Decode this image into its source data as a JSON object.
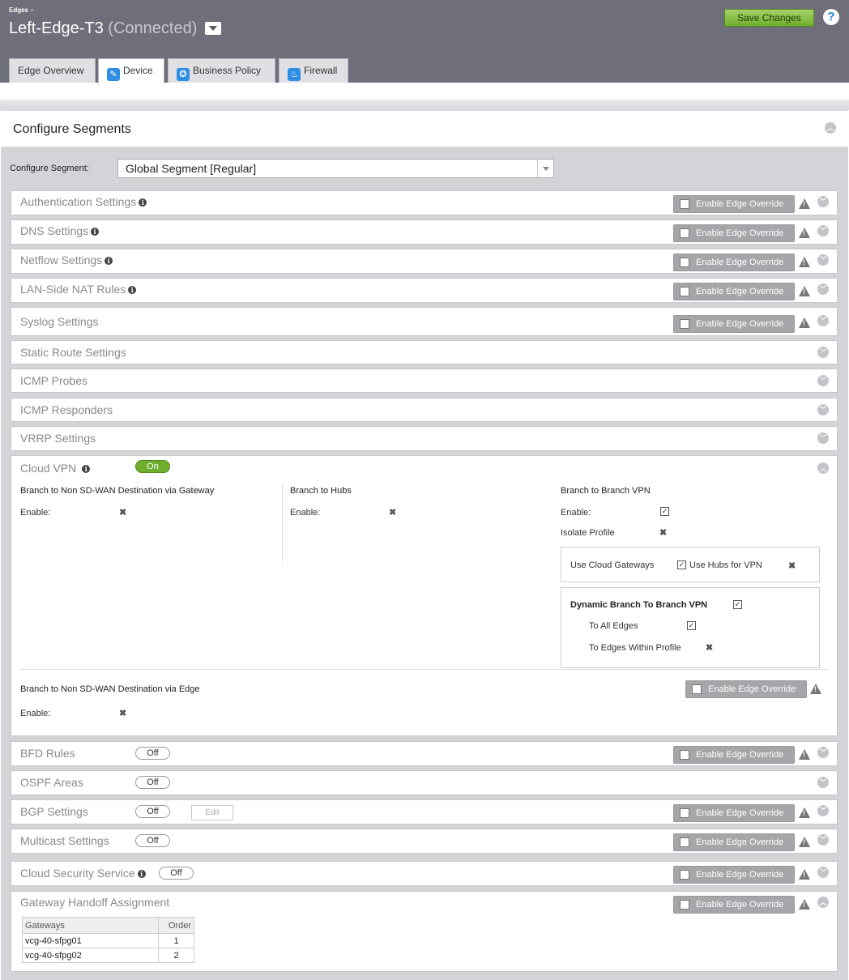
{
  "header": {
    "breadcrumb": "Edges",
    "breadcrumb_sep": "»",
    "edge_name": "Left-Edge-T3",
    "edge_status": "(Connected)",
    "save_label": "Save Changes",
    "help": "?"
  },
  "tabs": [
    {
      "label": "Edge Overview"
    },
    {
      "label": "Device"
    },
    {
      "label": "Business Policy"
    },
    {
      "label": "Firewall"
    }
  ],
  "section_title": "Configure Segments",
  "segment": {
    "label": "Configure Segment:",
    "value": "Global Segment [Regular]"
  },
  "override_label": "Enable Edge Override",
  "panels": {
    "auth": "Authentication Settings",
    "dns": "DNS Settings",
    "netflow": "Netflow Settings",
    "lan_nat": "LAN-Side NAT Rules",
    "syslog": "Syslog Settings",
    "static_route": "Static Route Settings",
    "icmp_probes": "ICMP Probes",
    "icmp_responders": "ICMP Responders",
    "vrrp": "VRRP Settings",
    "cloud_vpn": "Cloud VPN",
    "bfd": "BFD Rules",
    "ospf": "OSPF Areas",
    "bgp": "BGP Settings",
    "multicast": "Multicast Settings",
    "css": "Cloud Security Service",
    "gw_handoff": "Gateway Handoff Assignment"
  },
  "toggles": {
    "on": "On",
    "off": "Off"
  },
  "edit_label": "Edit",
  "vpn": {
    "gw_heading": "Branch to Non SD-WAN Destination via Gateway",
    "hubs_heading": "Branch to Hubs",
    "b2b_heading": "Branch to Branch VPN",
    "enable": "Enable:",
    "isolate": "Isolate Profile",
    "use_cloud_gw": "Use Cloud Gateways",
    "use_hubs": "Use Hubs for VPN",
    "dynamic": "Dynamic Branch To Branch VPN",
    "all_edges": "To All Edges",
    "within_profile": "To Edges Within Profile",
    "edge_heading": "Branch to Non SD-WAN Destination via Edge",
    "x": "✖",
    "check": "✓"
  },
  "gateway_table": {
    "headers": [
      "Gateways",
      "Order"
    ],
    "rows": [
      {
        "gateway": "vcg-40-sfpg01",
        "order": "1"
      },
      {
        "gateway": "vcg-40-sfpg02",
        "order": "2"
      }
    ]
  },
  "colors": {
    "accent_green": "#6fae2d",
    "header_bg": "#6f6f7b",
    "tab_icon_blue": "#2d8ee3"
  }
}
